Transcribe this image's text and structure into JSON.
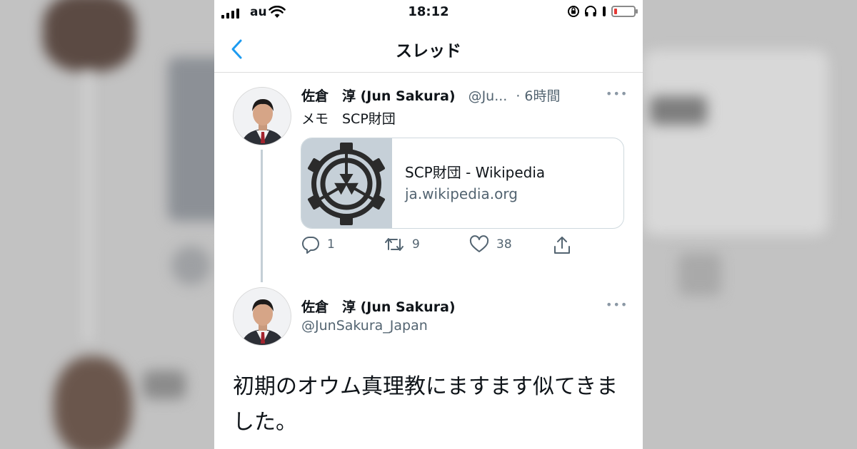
{
  "status_bar": {
    "carrier": "au",
    "time": "18:12"
  },
  "nav": {
    "title": "スレッド"
  },
  "tweet1": {
    "name": "佐倉　淳 (Jun Sakura)",
    "handle": "@Ju...",
    "time": "· 6時間",
    "text": "メモ　SCP財団",
    "card": {
      "title": "SCP財団 - Wikipedia",
      "domain": "ja.wikipedia.org"
    },
    "actions": {
      "replies": "1",
      "retweets": "9",
      "likes": "38"
    }
  },
  "tweet2": {
    "name": "佐倉　淳 (Jun Sakura)",
    "handle": "@JunSakura_Japan",
    "text": "初期のオウム真理教にますます似てきました。"
  },
  "colors": {
    "accent": "#1d9bf0",
    "secondary_text": "#536471",
    "battery_low": "#e53935"
  },
  "icons": [
    "back-chevron-icon",
    "reply-icon",
    "retweet-icon",
    "like-icon",
    "share-icon",
    "more-icon",
    "wifi-icon",
    "battery-icon",
    "scp-logo"
  ]
}
